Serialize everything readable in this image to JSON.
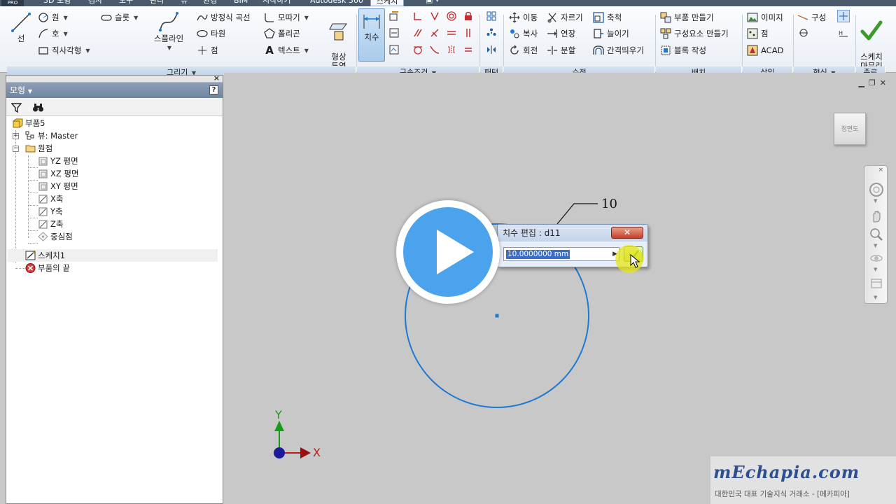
{
  "menubar": {
    "logo": "PRO",
    "tabs": [
      "3D 모형",
      "검사",
      "도구",
      "관리",
      "뷰",
      "환경",
      "BIM",
      "시작하기",
      "Autodesk 360",
      "스케치"
    ]
  },
  "ribbon": {
    "draw": {
      "line": "선",
      "circle": "원",
      "arc": "호",
      "rectangle": "직사각형",
      "slot": "슬롯",
      "spline": "스플라인",
      "equation_curve": "방정식 곡선",
      "ellipse": "타원",
      "point": "점",
      "fillet": "모따기",
      "polygon": "폴리곤",
      "text": "텍스트",
      "project": "형상\n투영",
      "label": "그리기"
    },
    "constrain": {
      "dimension": "치수",
      "label": "구속조건"
    },
    "pattern": {
      "label": "패턴"
    },
    "modify": {
      "move": "이동",
      "copy": "복사",
      "rotate": "회전",
      "trim": "자르기",
      "extend": "연장",
      "split": "분할",
      "scale": "축척",
      "stretch": "늘이기",
      "offset": "간격띄우기",
      "label": "수정"
    },
    "layout": {
      "make_part": "부품 만들기",
      "make_components": "구성요소 만들기",
      "create_block": "블록 작성",
      "label": "배치"
    },
    "insert": {
      "image": "이미지",
      "points": "점",
      "acad": "ACAD",
      "label": "삽입"
    },
    "format": {
      "construction": "구성",
      "label": "형식"
    },
    "exit": {
      "finish_sketch": "스케치\n마무리",
      "label": "종료"
    }
  },
  "browser": {
    "header": "모형",
    "tree": [
      {
        "label": "부품5"
      },
      {
        "label": "뷰: Master"
      },
      {
        "label": "원점"
      },
      {
        "label": "YZ 평면"
      },
      {
        "label": "XZ 평면"
      },
      {
        "label": "XY 평면"
      },
      {
        "label": "X축"
      },
      {
        "label": "Y축"
      },
      {
        "label": "Z축"
      },
      {
        "label": "중심점"
      },
      {
        "label": "스케치1"
      },
      {
        "label": "부품의 끝"
      }
    ]
  },
  "viewport": {
    "viewcube_label": "정면도",
    "dimension_value_label": "10",
    "axis_x": "X",
    "axis_y": "Y",
    "dialog": {
      "title": "치수 편집 : d11",
      "value": "10.0000000 mm"
    },
    "watermark": {
      "logo": "mEchapia.com",
      "tagline": "대한민국 대표 기술지식 거래소 - [메카피아]"
    }
  },
  "colors": {
    "sketch_circle": "#1f78d1",
    "play_button": "#4aa3ec",
    "x_axis": "#c01818",
    "y_axis": "#1a9a1a",
    "origin": "#1a1a9a"
  }
}
